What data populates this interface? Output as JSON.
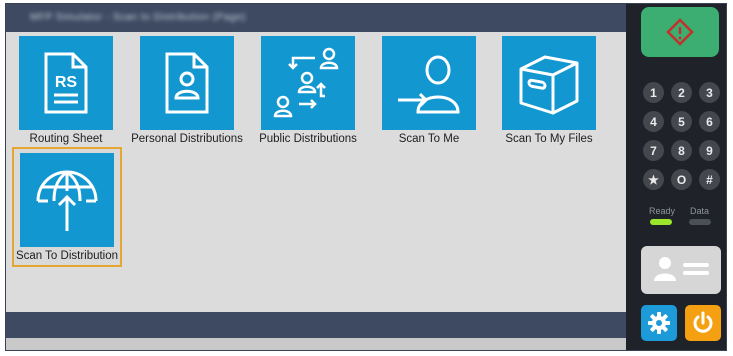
{
  "window": {
    "title": "MFP Simulator - Scan to Distribution (Page)"
  },
  "tiles": [
    {
      "label": "Routing Sheet",
      "icon": "routing-sheet-icon",
      "icon_text": "RS"
    },
    {
      "label": "Personal Distributions",
      "icon": "personal-distribution-icon"
    },
    {
      "label": "Public Distributions",
      "icon": "public-distributions-icon"
    },
    {
      "label": "Scan To Me",
      "icon": "scan-to-me-icon"
    },
    {
      "label": "Scan To My Files",
      "icon": "file-box-icon"
    },
    {
      "label": "Scan To Distribution",
      "icon": "globe-upload-icon",
      "selected": true
    }
  ],
  "keypad": {
    "keys": [
      "1",
      "2",
      "3",
      "4",
      "5",
      "6",
      "7",
      "8",
      "9",
      "★",
      "O",
      "#"
    ]
  },
  "status": {
    "ready_label": "Ready",
    "data_label": "Data",
    "ready_color": "#9be62a",
    "data_color": "#4b4f56"
  },
  "colors": {
    "tile": "#1297d0",
    "start": "#3cae71",
    "selection": "#e5a732",
    "settings": "#1d9ad8",
    "power": "#f5a012"
  }
}
